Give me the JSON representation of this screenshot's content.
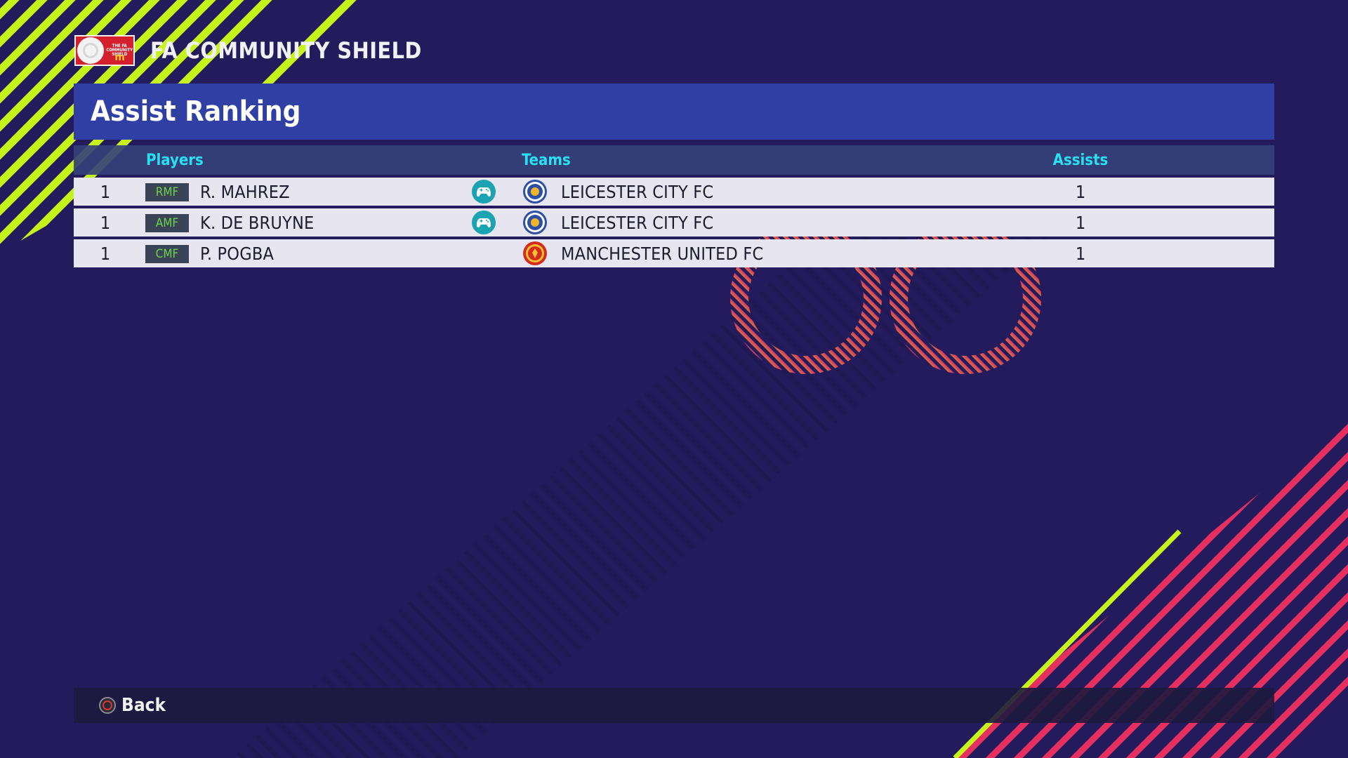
{
  "competition": {
    "name": "FA COMMUNITY SHIELD",
    "logo_text": "THE FA COMMUNITY SHIELD",
    "logo_mark": "m"
  },
  "panel": {
    "title": "Assist Ranking"
  },
  "columns": {
    "players": "Players",
    "teams": "Teams",
    "assists": "Assists"
  },
  "rows": [
    {
      "rank": "1",
      "position": "RMF",
      "player": "R. MAHREZ",
      "user_controlled": true,
      "team": "LEICESTER CITY FC",
      "team_crest": "leicester-crest-icon",
      "assists": "1"
    },
    {
      "rank": "1",
      "position": "AMF",
      "player": "K. DE BRUYNE",
      "user_controlled": true,
      "team": "LEICESTER CITY FC",
      "team_crest": "leicester-crest-icon",
      "assists": "1"
    },
    {
      "rank": "1",
      "position": "CMF",
      "player": "P. POGBA",
      "user_controlled": false,
      "team": "MANCHESTER UNITED FC",
      "team_crest": "man-utd-crest-icon",
      "assists": "1"
    }
  ],
  "footer": {
    "back_label": "Back",
    "back_icon": "circle-button-icon"
  },
  "colors": {
    "background": "#241b5c",
    "title_bar": "#2f3fa3",
    "header_text": "#27e0f0",
    "position_text": "#6bd34b",
    "accent_lime": "#c6f51e",
    "accent_pink": "#e5305f"
  }
}
